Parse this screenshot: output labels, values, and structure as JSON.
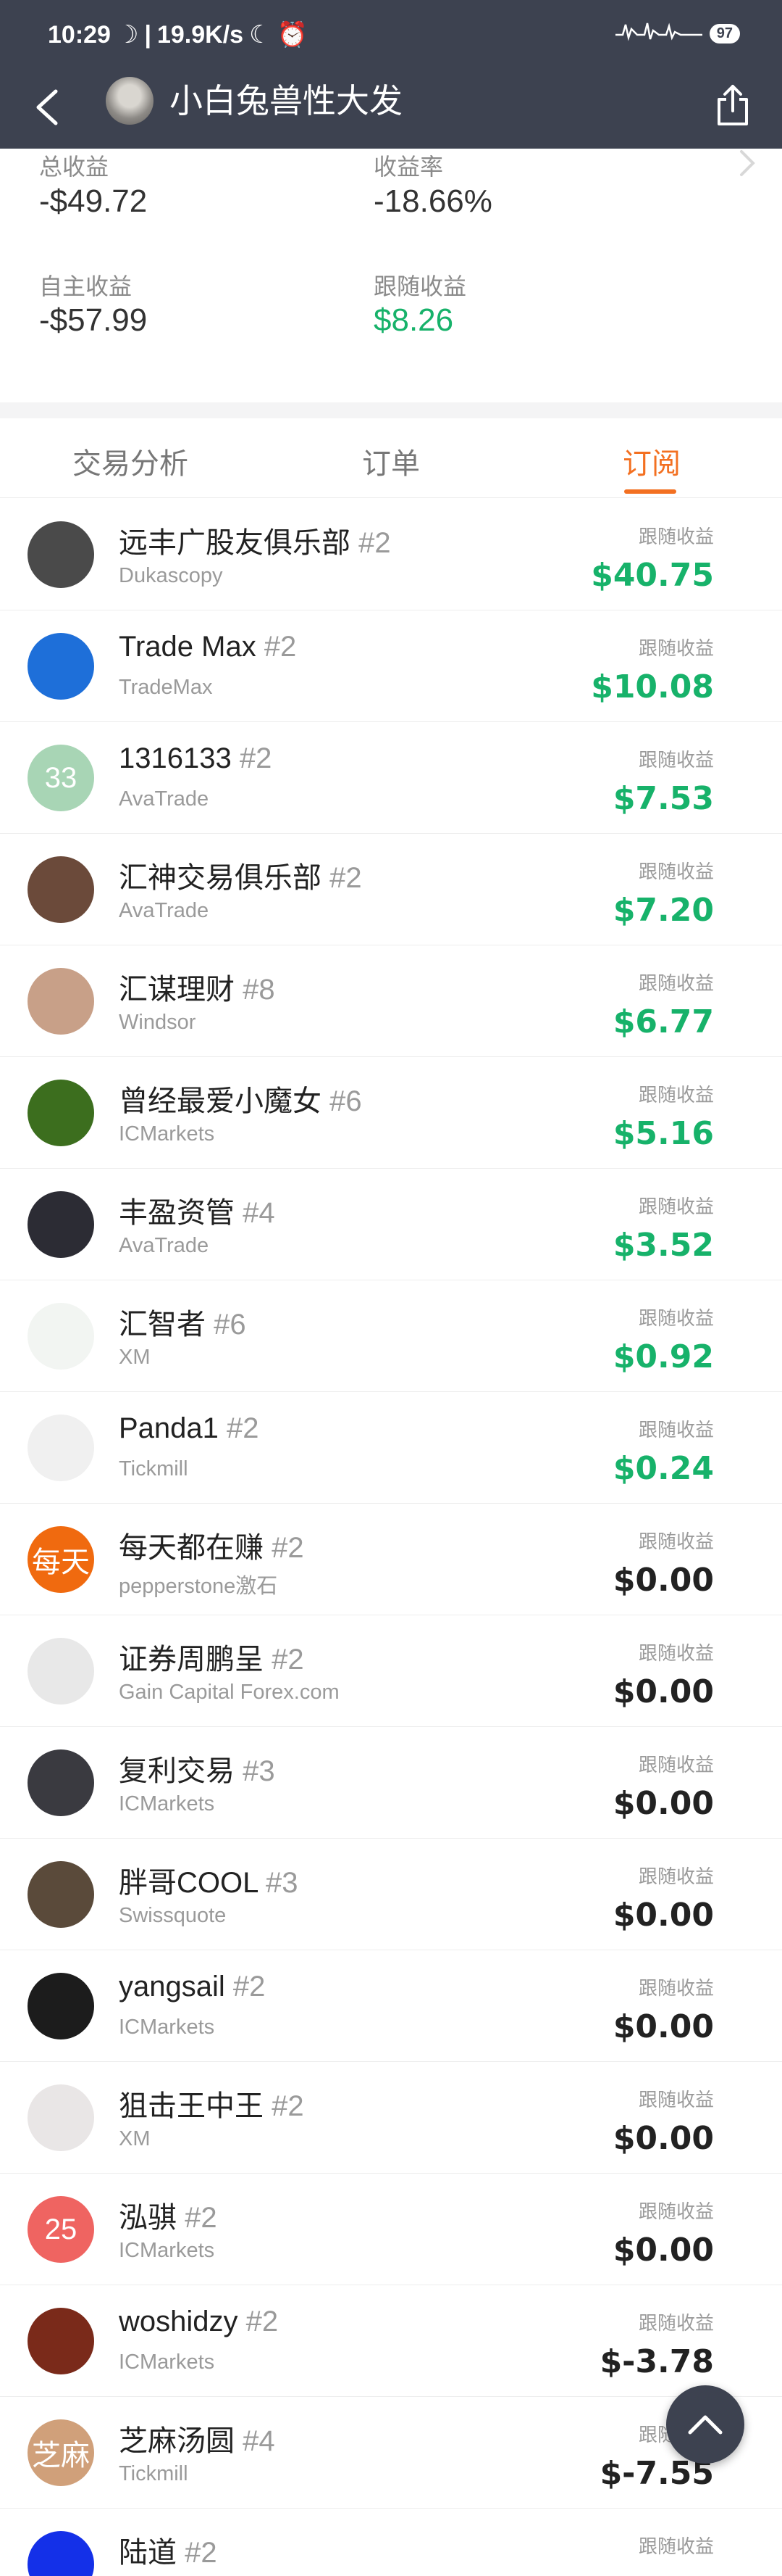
{
  "status": {
    "time": "10:29",
    "speed": "19.9K/s",
    "battery": "97"
  },
  "nav": {
    "title": "小白兔兽性大发"
  },
  "stats": {
    "total_label": "总收益",
    "total_value": "-$49.72",
    "rate_label": "收益率",
    "rate_value": "-18.66%",
    "own_label": "自主收益",
    "own_value": "-$57.99",
    "follow_label": "跟随收益",
    "follow_value": "$8.26"
  },
  "tabs": [
    {
      "label": "交易分析"
    },
    {
      "label": "订单"
    },
    {
      "label": "订阅"
    }
  ],
  "list_value_label": "跟随收益",
  "items": [
    {
      "name": "远丰广股友俱乐部",
      "tag": "#2",
      "broker": "Dukascopy",
      "value": "$40.75",
      "avatar_text": "",
      "avatar_color": "#4a4a4a"
    },
    {
      "name": "Trade Max",
      "tag": "#2",
      "broker": "TradeMax",
      "value": "$10.08",
      "avatar_text": "",
      "avatar_color": "#1e6fd9"
    },
    {
      "name": "1316133",
      "tag": "#2",
      "broker": "AvaTrade",
      "value": "$7.53",
      "avatar_text": "33",
      "avatar_color": "#a8d5b5"
    },
    {
      "name": "汇神交易俱乐部",
      "tag": "#2",
      "broker": "AvaTrade",
      "value": "$7.20",
      "avatar_text": "",
      "avatar_color": "#6b4a3a"
    },
    {
      "name": "汇谋理财",
      "tag": "#8",
      "broker": "Windsor",
      "value": "$6.77",
      "avatar_text": "",
      "avatar_color": "#c8a088"
    },
    {
      "name": "曾经最爱小魔女",
      "tag": "#6",
      "broker": "ICMarkets",
      "value": "$5.16",
      "avatar_text": "",
      "avatar_color": "#3c6e1e"
    },
    {
      "name": "丰盈资管",
      "tag": "#4",
      "broker": "AvaTrade",
      "value": "$3.52",
      "avatar_text": "",
      "avatar_color": "#2c2c34"
    },
    {
      "name": "汇智者",
      "tag": "#6",
      "broker": "XM",
      "value": "$0.92",
      "avatar_text": "",
      "avatar_color": "#f2f5f2"
    },
    {
      "name": "Panda1",
      "tag": "#2",
      "broker": "Tickmill",
      "value": "$0.24",
      "avatar_text": "",
      "avatar_color": "#f0f0f0"
    },
    {
      "name": "每天都在赚",
      "tag": "#2",
      "broker": "pepperstone激石",
      "value": "$0.00",
      "avatar_text": "每天",
      "avatar_color": "#f06a0f"
    },
    {
      "name": "证券周鹏呈",
      "tag": "#2",
      "broker": "Gain Capital Forex.com",
      "value": "$0.00",
      "avatar_text": "",
      "avatar_color": "#e8e8e8"
    },
    {
      "name": "复利交易",
      "tag": "#3",
      "broker": "ICMarkets",
      "value": "$0.00",
      "avatar_text": "",
      "avatar_color": "#3a3a40"
    },
    {
      "name": "胖哥COOL",
      "tag": "#3",
      "broker": "Swissquote",
      "value": "$0.00",
      "avatar_text": "",
      "avatar_color": "#5a4a3a"
    },
    {
      "name": "yangsail",
      "tag": "#2",
      "broker": "ICMarkets",
      "value": "$0.00",
      "avatar_text": "",
      "avatar_color": "#1c1c1c"
    },
    {
      "name": "狙击王中王",
      "tag": "#2",
      "broker": "XM",
      "value": "$0.00",
      "avatar_text": "",
      "avatar_color": "#e9e6e6"
    },
    {
      "name": "泓骐",
      "tag": "#2",
      "broker": "ICMarkets",
      "value": "$0.00",
      "avatar_text": "25",
      "avatar_color": "#ef6461"
    },
    {
      "name": "woshidzy",
      "tag": "#2",
      "broker": "ICMarkets",
      "value": "$-3.78",
      "avatar_text": "",
      "avatar_color": "#7a2a1a"
    },
    {
      "name": "芝麻汤圆",
      "tag": "#4",
      "broker": "Tickmill",
      "value": "$-7.55",
      "avatar_text": "芝麻",
      "avatar_color": "#d0a07a"
    },
    {
      "name": "陆道",
      "tag": "#2",
      "broker": "",
      "value": "",
      "avatar_text": "",
      "avatar_color": "#1430e8"
    }
  ]
}
